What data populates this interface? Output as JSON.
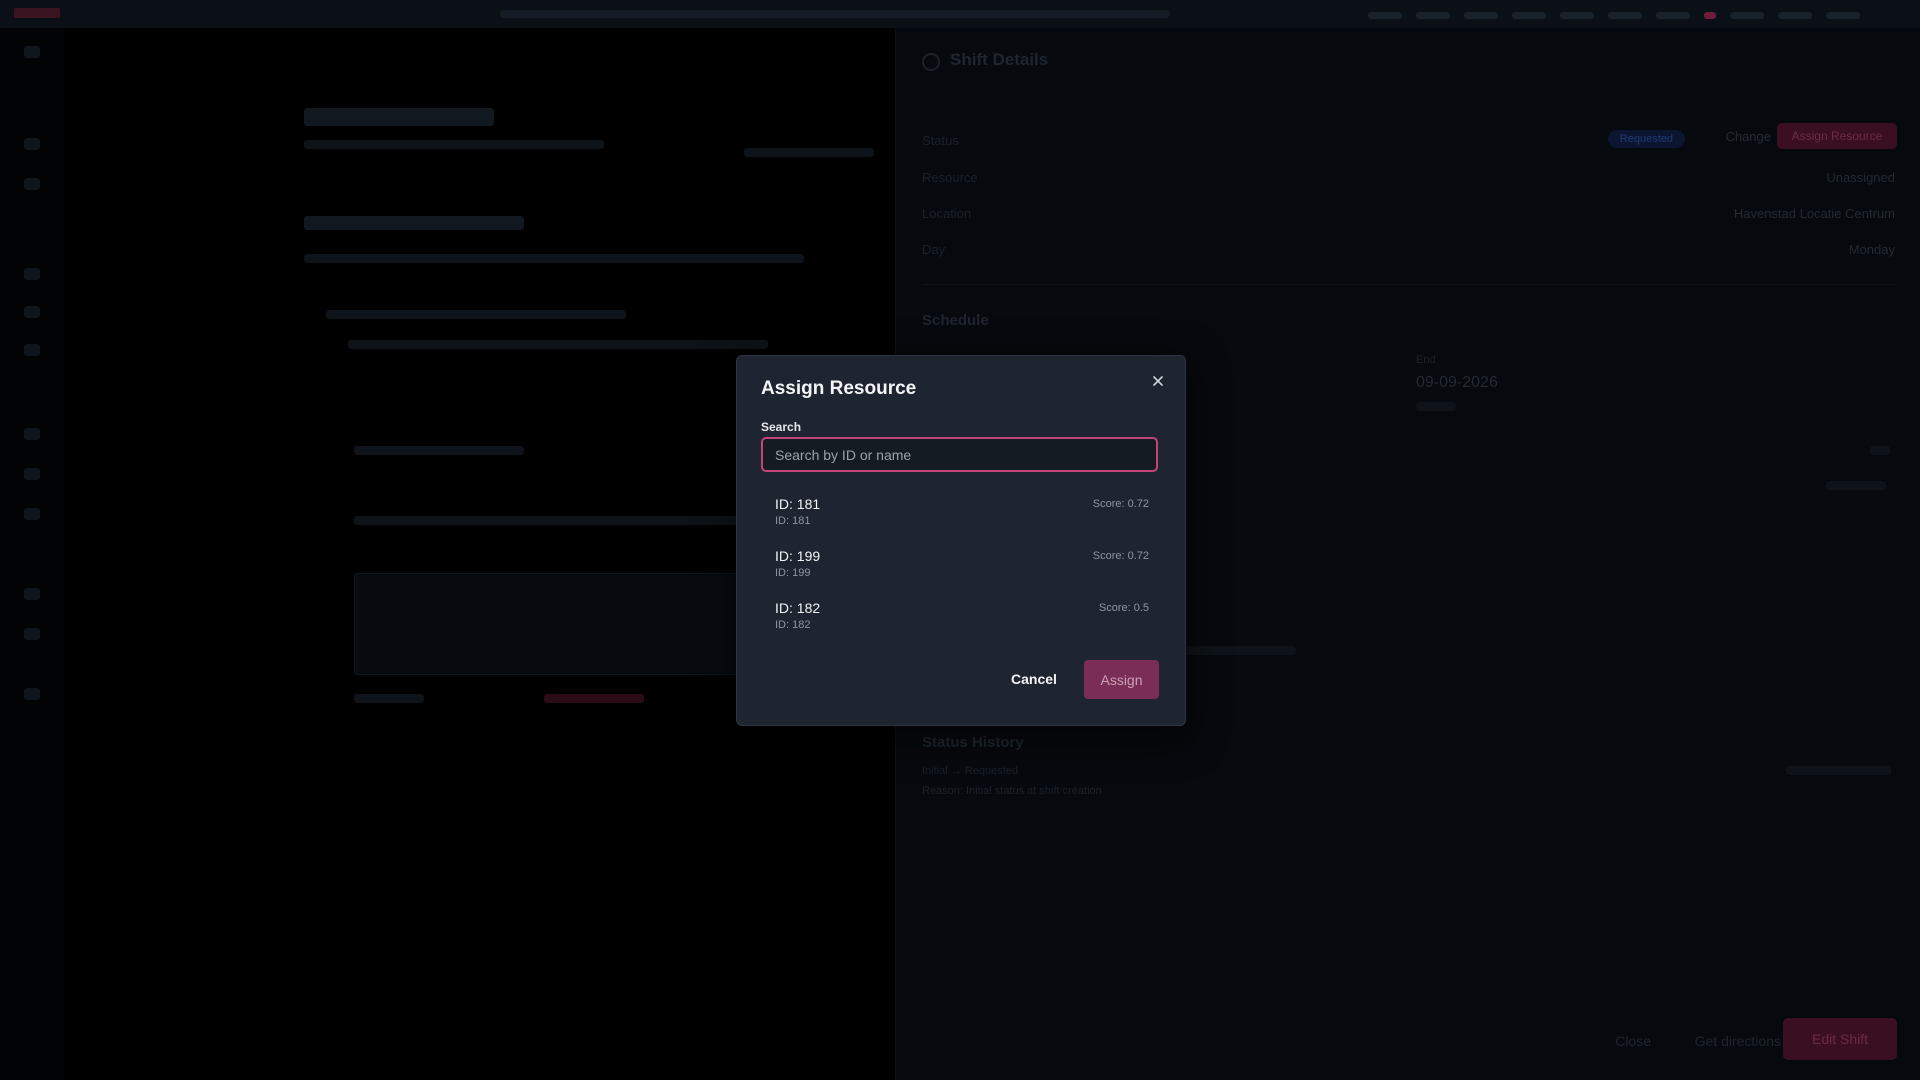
{
  "drawer": {
    "title": "Shift Details",
    "status_label": "Status",
    "status_value": "Requested",
    "change_label": "Change",
    "assign_resource_label": "Assign Resource",
    "resource_label": "Resource",
    "resource_value": "Unassigned",
    "location_label": "Location",
    "location_value": "Havenstad Locatie Centrum",
    "day_label": "Day",
    "day_value": "Monday",
    "schedule_title": "Schedule",
    "end_label": "End",
    "end_date": "09-09-2026",
    "status_history_title": "Status History",
    "history_entry": "Initial → Requested",
    "history_reason": "Reason: Initial status at shift creation",
    "footer_close": "Close",
    "footer_directions": "Get directions",
    "footer_edit": "Edit Shift"
  },
  "modal": {
    "title": "Assign Resource",
    "search_label": "Search",
    "search_placeholder": "Search by ID or name",
    "results": [
      {
        "name": "ID: 181",
        "sub": "ID: 181",
        "score": "Score: 0.72"
      },
      {
        "name": "ID: 199",
        "sub": "ID: 199",
        "score": "Score: 0.72"
      },
      {
        "name": "ID: 182",
        "sub": "ID: 182",
        "score": "Score: 0.5"
      }
    ],
    "cancel_label": "Cancel",
    "assign_label": "Assign"
  }
}
